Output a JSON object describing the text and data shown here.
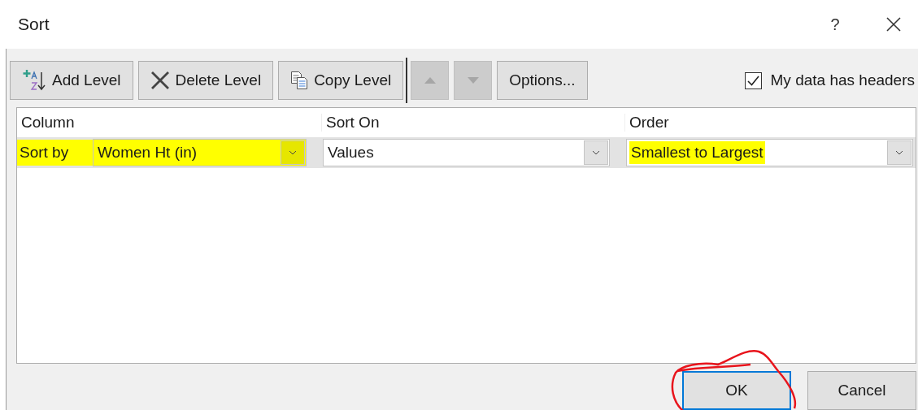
{
  "window": {
    "title": "Sort",
    "help": "?"
  },
  "toolbar": {
    "buttons": [
      {
        "kind": "add",
        "label": "Add Level",
        "disabled": false
      },
      {
        "kind": "delete",
        "label": "Delete Level",
        "disabled": false
      },
      {
        "kind": "copy",
        "label": "Copy Level",
        "disabled": false
      },
      {
        "kind": "move_up",
        "disabled": true
      },
      {
        "kind": "move_down",
        "disabled": true
      },
      {
        "kind": "options",
        "label": "Options...",
        "disabled": false
      }
    ],
    "headers_checkbox": {
      "label": "My data has headers",
      "checked": true
    }
  },
  "grid": {
    "columns": [
      "Column",
      "Sort On",
      "Order"
    ],
    "rows": [
      {
        "label": "Sort by",
        "label_highlighted": true,
        "selected": true,
        "column": {
          "value": "Women Ht (in)",
          "highlighted": true
        },
        "sort_on": {
          "value": "Values",
          "highlighted": false
        },
        "order": {
          "value": "Smallest to Largest",
          "highlighted": true
        }
      }
    ]
  },
  "footer": {
    "buttons": [
      {
        "label": "OK",
        "default": true,
        "circled": true
      },
      {
        "label": "Cancel",
        "default": false,
        "circled": false
      }
    ]
  }
}
